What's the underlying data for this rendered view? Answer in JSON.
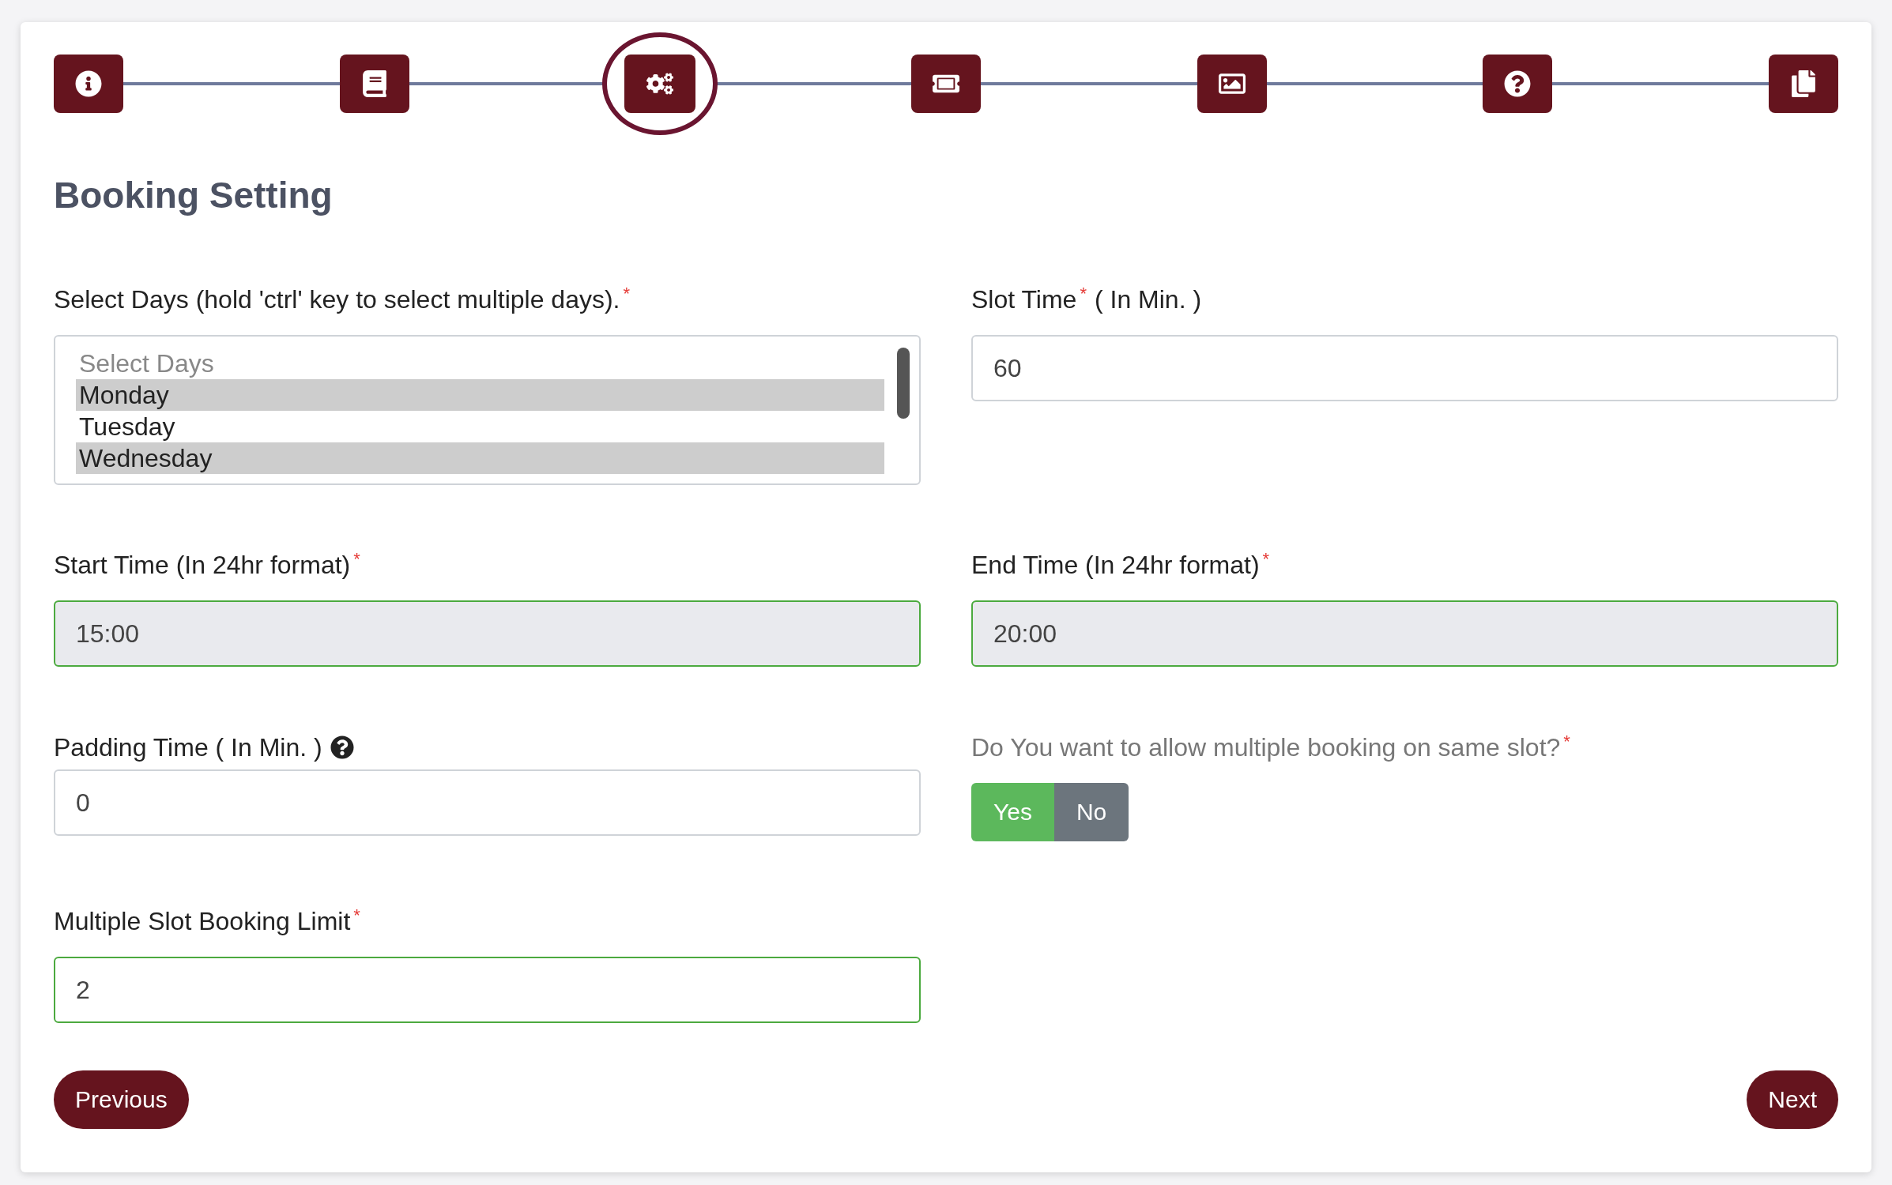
{
  "steps": [
    {
      "kind": "info",
      "selected": false
    },
    {
      "kind": "book",
      "selected": false
    },
    {
      "kind": "gears",
      "selected": true
    },
    {
      "kind": "ticket",
      "selected": false
    },
    {
      "kind": "image",
      "selected": false
    },
    {
      "kind": "question",
      "selected": false
    },
    {
      "kind": "documents",
      "selected": false
    }
  ],
  "title": "Booking Setting",
  "days": {
    "label": "Select Days (hold 'ctrl' key to select multiple days).",
    "required": "*",
    "options": [
      {
        "label": "Select Days",
        "placeholder": true,
        "selected": false
      },
      {
        "label": "Monday",
        "placeholder": false,
        "selected": true
      },
      {
        "label": "Tuesday",
        "placeholder": false,
        "selected": false
      },
      {
        "label": "Wednesday",
        "placeholder": false,
        "selected": true
      }
    ]
  },
  "slot_time": {
    "label": "Slot Time",
    "required": "*",
    "suffix": "( In Min. )",
    "value": "60",
    "valid": false,
    "disabled": false
  },
  "start_time": {
    "label": "Start Time (In 24hr format)",
    "required": "*",
    "value": "15:00",
    "valid": true,
    "disabled": true
  },
  "end_time": {
    "label": "End Time (In 24hr format)",
    "required": "*",
    "value": "20:00",
    "valid": true,
    "disabled": true
  },
  "padding_time": {
    "label": "Padding Time ( In Min. )",
    "help": true,
    "value": "0",
    "valid": false,
    "disabled": false
  },
  "multiple_booking": {
    "label": "Do You want to allow multiple booking on same slot?",
    "required": "*",
    "options": [
      {
        "label": "Yes",
        "selected": true
      },
      {
        "label": "No",
        "selected": false
      }
    ]
  },
  "slot_limit": {
    "label": "Multiple Slot Booking Limit",
    "required": "*",
    "value": "2",
    "valid": true,
    "disabled": false
  },
  "buttons": {
    "previous": "Previous",
    "next": "Next"
  }
}
